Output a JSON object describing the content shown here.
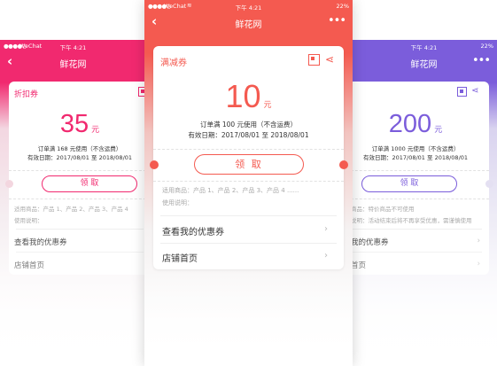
{
  "colors": {
    "red": "#f45a50",
    "pink": "#f1296f",
    "purple": "#7b5ddb"
  },
  "status": {
    "dots": "●●●●○",
    "wifi_icon": "wifi-icon",
    "battery_icon": "battery-icon"
  },
  "left": {
    "carrier": "WeChat",
    "time": "下午 4:21",
    "nav_title": "鲜花网",
    "type_label": "折扣券",
    "amount": "35",
    "unit": "元",
    "condition": "订单满 168 元使用（不含运费）",
    "validity": "有效日期：2017/08/01 至 2018/08/01",
    "button": "领 取",
    "products": "适用商品：产品 1、产品 2、产品 3、产品 4",
    "usage": "使用说明：",
    "link_coupons": "查看我的优惠券",
    "link_home": "店铺首页"
  },
  "center": {
    "carrier": "WeChat",
    "time": "下午 4:21",
    "battery": "22%",
    "nav_title": "鲜花网",
    "type_label": "满减券",
    "amount": "10",
    "unit": "元",
    "condition": "订单满 100 元使用（不含运费）",
    "validity": "有效日期：2017/08/01 至 2018/08/01",
    "button": "领 取",
    "products": "适用商品：产品 1、产品 2、产品 3、产品 4 ......",
    "usage": "使用说明：",
    "link_coupons": "查看我的优惠券",
    "link_home": "店铺首页"
  },
  "right": {
    "time": "下午 4:21",
    "battery": "22%",
    "nav_title": "鲜花网",
    "amount": "200",
    "unit": "元",
    "condition": "订单满 1000 元使用（不含运费）",
    "validity": "有效日期：2017/08/01 至 2018/08/01",
    "button": "领 取",
    "products": "商品：特价商品不可使用",
    "usage": "说明：活动结束后将不再享受优惠，需谨慎使用",
    "link_coupons": "我的优惠券",
    "link_home": "首页"
  }
}
